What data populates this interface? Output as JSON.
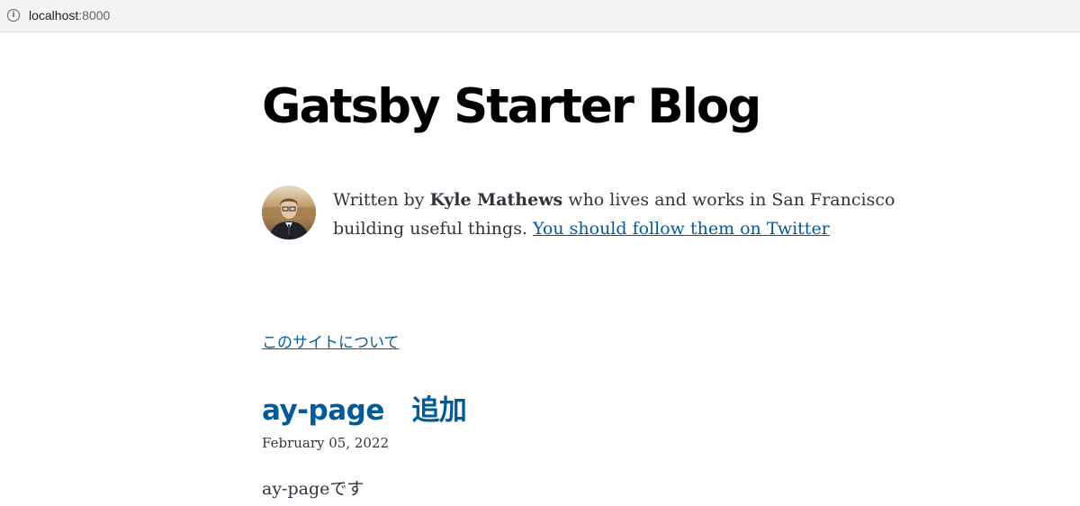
{
  "browser": {
    "url_host": "localhost",
    "url_port": ":8000"
  },
  "site": {
    "title": "Gatsby Starter Blog"
  },
  "bio": {
    "prefix": "Written by ",
    "author": "Kyle Mathews",
    "middle": " who lives and works in San Francisco building useful things. ",
    "twitter_link": "You should follow them on Twitter"
  },
  "nav": {
    "about_link": "このサイトについて"
  },
  "posts": [
    {
      "title": "ay-page　追加",
      "date": "February 05, 2022",
      "excerpt": "ay-pageです"
    }
  ],
  "colors": {
    "link": "#005b99",
    "text": "#2e353f",
    "heading": "#000000"
  }
}
